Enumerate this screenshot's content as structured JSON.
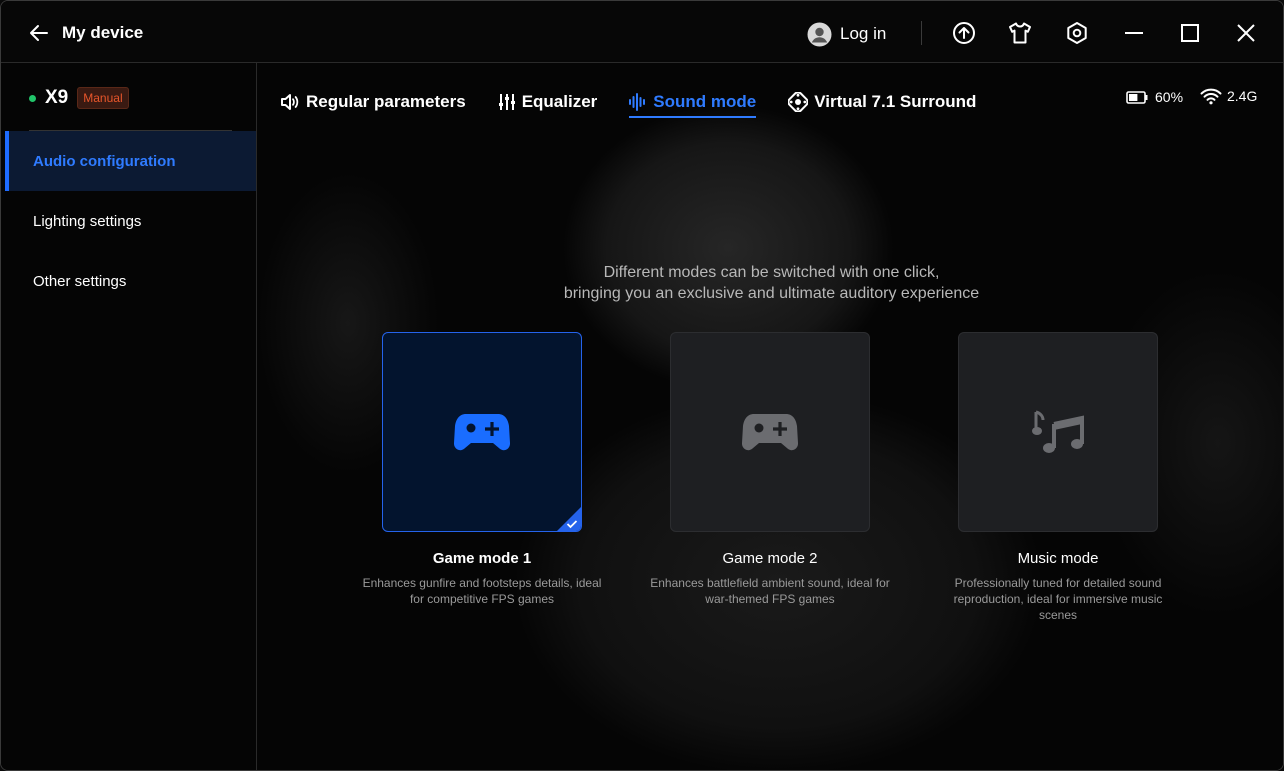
{
  "titlebar": {
    "title": "My device",
    "login_label": "Log in"
  },
  "device": {
    "name": "X9",
    "badge": "Manual",
    "status_color": "#21c46a"
  },
  "sidebar": {
    "items": [
      {
        "label": "Audio configuration",
        "active": true
      },
      {
        "label": "Lighting settings",
        "active": false
      },
      {
        "label": "Other settings",
        "active": false
      }
    ]
  },
  "tabs": [
    {
      "label": "Regular parameters",
      "icon": "speaker-icon"
    },
    {
      "label": "Equalizer",
      "icon": "equalizer-icon"
    },
    {
      "label": "Sound mode",
      "icon": "soundwave-icon",
      "active": true
    },
    {
      "label": "Virtual 7.1 Surround",
      "icon": "surround-icon"
    }
  ],
  "status": {
    "battery": "60%",
    "battery_level": 0.6,
    "connection": "2.4G"
  },
  "intro": {
    "line1": "Different modes can be switched with one click,",
    "line2": "bringing you an exclusive and ultimate auditory experience"
  },
  "modes": [
    {
      "title": "Game mode 1",
      "desc": "Enhances gunfire and footsteps details, ideal for competitive FPS games",
      "icon": "gamepad-icon",
      "selected": true
    },
    {
      "title": "Game mode 2",
      "desc": "Enhances battlefield ambient sound, ideal for war-themed FPS games",
      "icon": "gamepad-icon",
      "selected": false
    },
    {
      "title": "Music mode",
      "desc": "Professionally tuned for detailed sound reproduction, ideal for immersive music scenes",
      "icon": "music-notes-icon",
      "selected": false
    }
  ],
  "colors": {
    "accent": "#2f7bff",
    "badge": "#e8562b"
  }
}
